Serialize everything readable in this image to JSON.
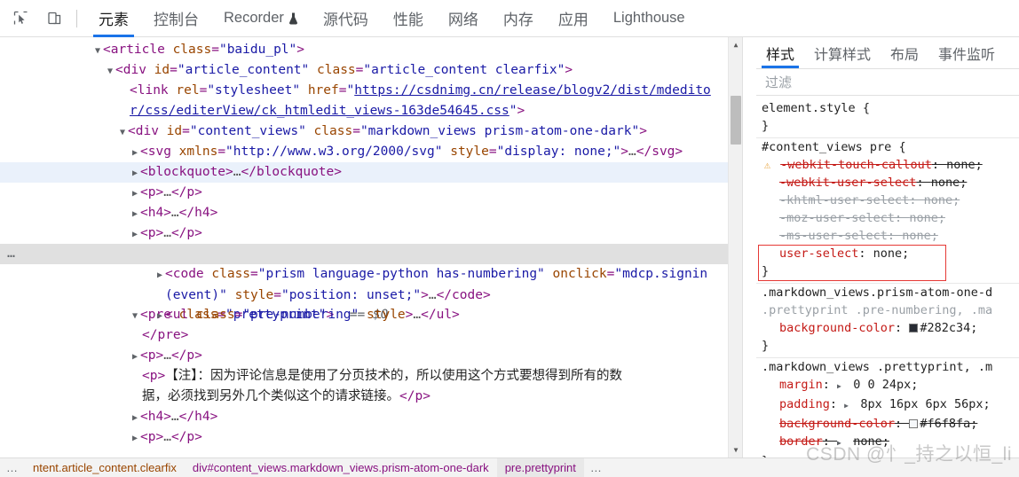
{
  "toolbar": {
    "inspect_icon": "inspect-cursor-icon",
    "device_icon": "device-toggle-icon",
    "tabs": [
      {
        "label": "元素",
        "active": true
      },
      {
        "label": "控制台",
        "active": false
      },
      {
        "label": "Recorder",
        "active": false,
        "badge_icon": "flask-icon"
      },
      {
        "label": "源代码",
        "active": false
      },
      {
        "label": "性能",
        "active": false
      },
      {
        "label": "网络",
        "active": false
      },
      {
        "label": "内存",
        "active": false
      },
      {
        "label": "应用",
        "active": false
      },
      {
        "label": "Lighthouse",
        "active": false
      }
    ]
  },
  "dom": {
    "rows": [
      {
        "id": "r1",
        "text": "<article class=\"baidu_pl\">"
      },
      {
        "id": "r2",
        "text": "<div id=\"article_content\" class=\"article_content clearfix\">"
      },
      {
        "id": "r3",
        "text": "<link rel=\"stylesheet\" href=\"https://csdnimg.cn/release/blogv2/dist/mdeditor/css/editerView/ck_htmledit_views-163de54645.css\">"
      },
      {
        "id": "r4",
        "text": "<div id=\"content_views\" class=\"markdown_views prism-atom-one-dark\">"
      },
      {
        "id": "r5",
        "text": "<svg xmlns=\"http://www.w3.org/2000/svg\" style=\"display: none;\">…</svg>"
      },
      {
        "id": "r6",
        "text": "<blockquote>…</blockquote>"
      },
      {
        "id": "r7",
        "text": "<p>…</p>"
      },
      {
        "id": "r8",
        "text": "<h4>…</h4>"
      },
      {
        "id": "r9",
        "text": "<p>…</p>"
      },
      {
        "id": "r10",
        "text": "<pre class=\"prettyprint\">  == $0"
      },
      {
        "id": "r11",
        "text": "<code class=\"prism language-python has-numbering\" onclick=\"mdcp.signin(event)\" style=\"position: unset;\">…</code>"
      },
      {
        "id": "r12",
        "text": "<ul class=\"pre-numbering\" style>…</ul>"
      },
      {
        "id": "r13",
        "text": "</pre>"
      },
      {
        "id": "r14",
        "text": "<p>…</p>"
      },
      {
        "id": "r15",
        "text": "<p>【注】：因为评论信息是使用了分页技术的，所以使用这个方式要想得到所有的数据，必须找到另外几个类似这个的请求链接。</p>"
      },
      {
        "id": "r16",
        "text": "<h4>…</h4>"
      },
      {
        "id": "r17",
        "text": "<p>…</p>"
      }
    ],
    "selected_marker": "== $0",
    "gutter_more": "…",
    "scroll_up_arrow": "▲",
    "scroll_down_arrow": "▼"
  },
  "styles": {
    "tabs": [
      {
        "label": "样式",
        "active": true
      },
      {
        "label": "计算样式",
        "active": false
      },
      {
        "label": "布局",
        "active": false
      },
      {
        "label": "事件监听",
        "active": false
      }
    ],
    "filter_placeholder": "过滤",
    "filter_value": "",
    "rules": [
      {
        "selector": "element.style",
        "open_brace": "{",
        "close_brace": "}",
        "declarations": []
      },
      {
        "selector": "#content_views pre",
        "open_brace": "{",
        "close_brace": "}",
        "declarations": [
          {
            "prop": "-webkit-touch-callout",
            "value": "none;",
            "struck": true,
            "warn": true
          },
          {
            "prop": "-webkit-user-select",
            "value": "none;",
            "struck": true,
            "warn": false
          },
          {
            "prop": "-khtml-user-select",
            "value": "none;",
            "struck": true,
            "dim": true
          },
          {
            "prop": "-moz-user-select",
            "value": "none;",
            "struck": true,
            "dim": true
          },
          {
            "prop": "-ms-user-select",
            "value": "none;",
            "struck": true,
            "dim": true
          },
          {
            "prop": "user-select",
            "value": "none;",
            "struck": false,
            "highlighted": true
          }
        ]
      },
      {
        "selector": "​.markdown_views.prism-atom-one-d",
        "selector_line2": ".prettyprint .pre-numbering, .ma",
        "open_brace": "{",
        "close_brace": "}",
        "declarations": [
          {
            "prop": "background-color",
            "value": "#282c34;",
            "swatch": "#282c34"
          }
        ]
      },
      {
        "selector": ".markdown_views .prettyprint, .m",
        "open_brace": "{",
        "close_brace": "}",
        "declarations": [
          {
            "prop": "margin",
            "value": "0 0 24px;",
            "expandable": true
          },
          {
            "prop": "padding",
            "value": "8px 16px 6px 56px;",
            "expandable": true
          },
          {
            "prop": "background-color",
            "value": "#f6f8fa;",
            "swatch": "#f6f8fa",
            "struck": true
          },
          {
            "prop": "border",
            "value": "none;",
            "expandable": true,
            "struck": true
          }
        ]
      }
    ]
  },
  "breadcrumb": {
    "overflow_left": "…",
    "overflow_right": "…",
    "items": [
      {
        "text": "ntent.article_content.clearfix",
        "tag": "",
        "active": false
      },
      {
        "text": "div#content_views.markdown_views.prism-atom-one-dark",
        "tag": "div",
        "active": false
      },
      {
        "text": "pre.prettyprint",
        "tag": "pre",
        "active": true
      }
    ]
  },
  "watermark": {
    "text": "CSDN @忄_持之以恒_li"
  },
  "colors": {
    "accent": "#1a73e8",
    "tag": "#881280",
    "attr_name": "#994500",
    "attr_value": "#1a1aa6",
    "property": "#c41a16",
    "highlight_box": "#e53935",
    "selected_row": "#eaf1fb",
    "breadcrumb_bg": "#f3f3f3"
  }
}
